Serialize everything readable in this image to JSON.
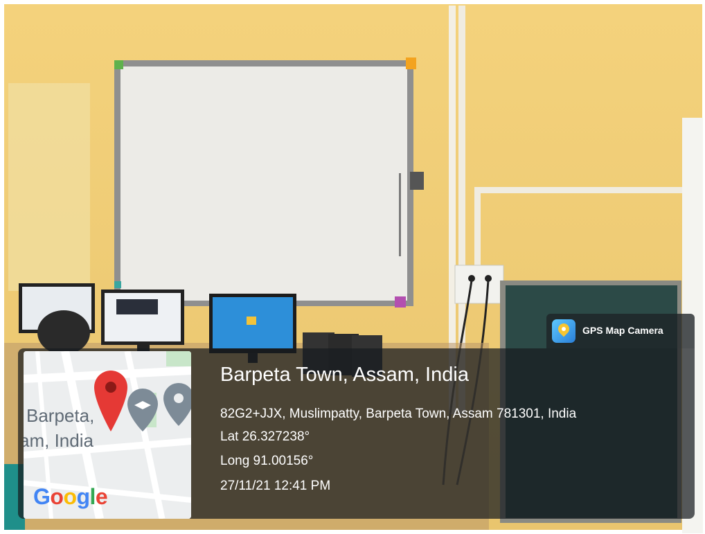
{
  "scene": {
    "description_colors": {
      "wall": "#f2cf7a",
      "whiteboard": "#eceae6",
      "chalkboard": "#2c4a47",
      "monitor_screen": "#2d8fd9"
    }
  },
  "badge": {
    "icon": "gps-map-camera-icon",
    "label": "GPS Map Camera"
  },
  "map": {
    "label_line1": "Barpeta,",
    "label_line2": "am, India",
    "logo": [
      "G",
      "o",
      "o",
      "g",
      "l",
      "e"
    ],
    "logo_colors": [
      "#4285F4",
      "#EA4335",
      "#FBBC05",
      "#4285F4",
      "#34A853",
      "#EA4335"
    ],
    "pin_color": "#e53935"
  },
  "info": {
    "place": "Barpeta Town, Assam, India",
    "address": "82G2+JJX, Muslimpatty, Barpeta Town, Assam 781301, India",
    "latitude": "Lat 26.327238°",
    "longitude": "Long 91.00156°",
    "datetime": "27/11/21 12:41 PM"
  }
}
